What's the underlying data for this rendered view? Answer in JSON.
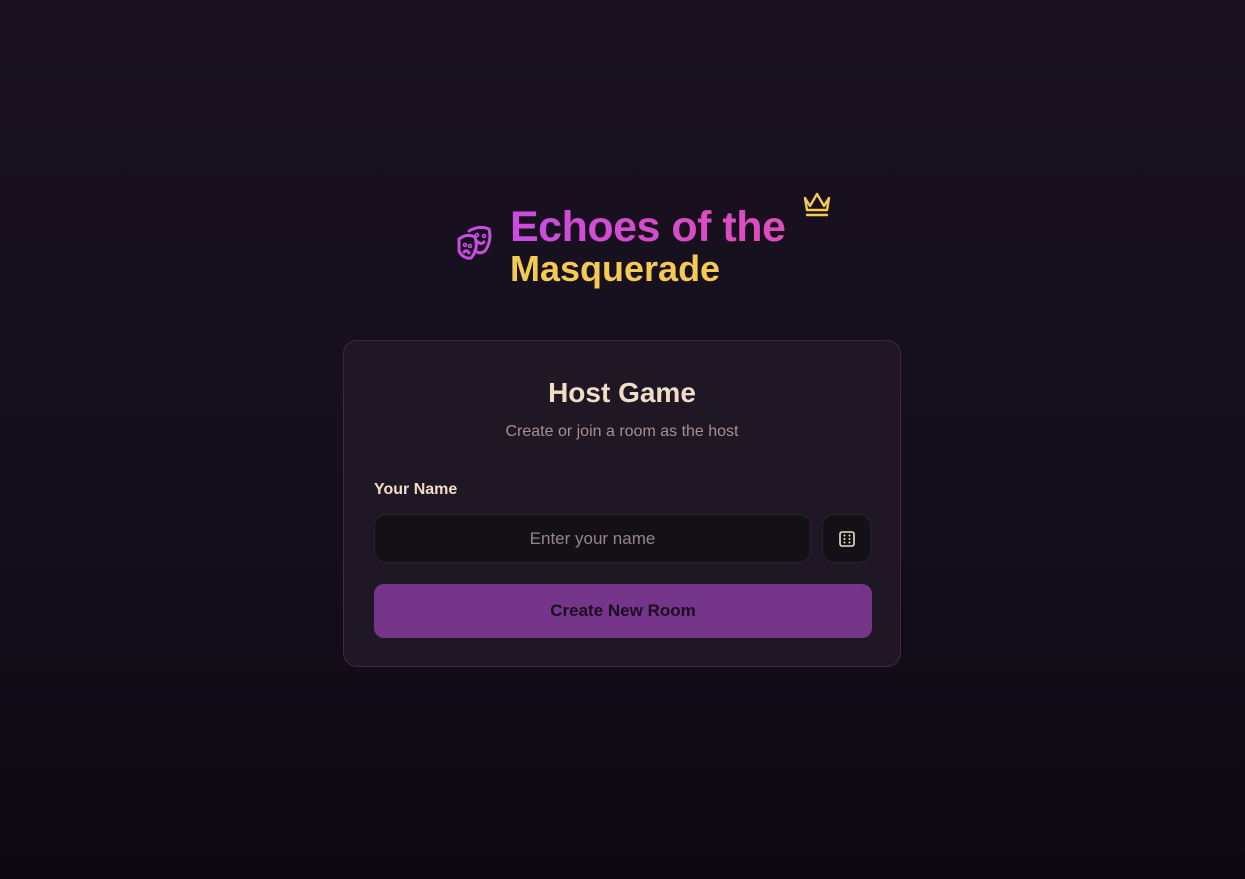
{
  "logo": {
    "title_line1": "Echoes of the",
    "title_line2": "Masquerade",
    "icon_left": "theater-masks-icon",
    "icon_right": "crown-icon"
  },
  "card": {
    "title": "Host Game",
    "subtitle": "Create or join a room as the host",
    "name_label": "Your Name",
    "name_value": "",
    "name_placeholder": "Enter your name",
    "random_icon": "dice-icon",
    "create_label": "Create New Room"
  },
  "colors": {
    "accent": "#74358a",
    "gold": "#f5c955",
    "pink": "#d04ed6"
  }
}
